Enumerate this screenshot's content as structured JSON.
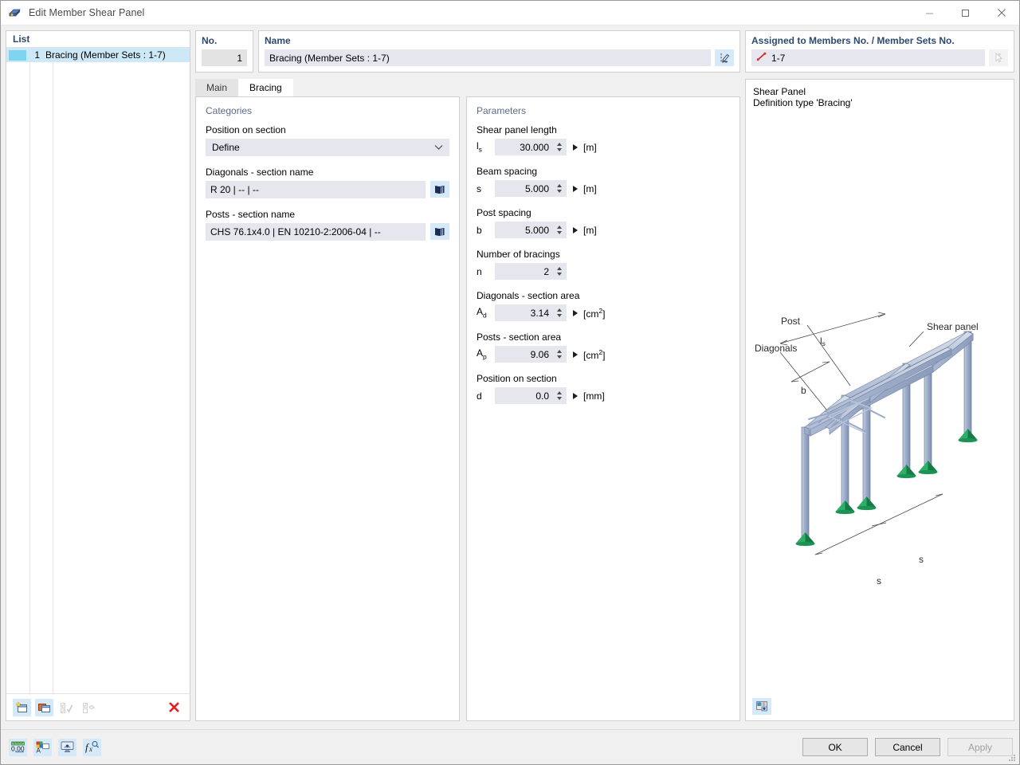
{
  "window": {
    "title": "Edit Member Shear Panel",
    "app_icon": "shear-panel-icon",
    "minimize_label": "—",
    "maximize_label": "□",
    "close_label": "✕"
  },
  "list_panel": {
    "header": "List",
    "rows": [
      {
        "color": "#7fd4f0",
        "no": "1",
        "label": "Bracing (Member Sets : 1-7)",
        "selected": true
      }
    ],
    "toolbar": [
      {
        "name": "new-item-button",
        "icon": "new-window-icon",
        "enabled": true
      },
      {
        "name": "copy-item-button",
        "icon": "copy-window-icon",
        "enabled": true
      },
      {
        "name": "select-all-button",
        "icon": "check-list-icon",
        "enabled": false
      },
      {
        "name": "invert-selection-button",
        "icon": "invert-list-icon",
        "enabled": false
      },
      {
        "name": "delete-item-button",
        "icon": "red-x-icon",
        "enabled": true
      }
    ]
  },
  "no_field": {
    "label": "No.",
    "value": "1"
  },
  "name_field": {
    "label": "Name",
    "value": "Bracing (Member Sets : 1-7)",
    "edit_button_icon": "pencil-edit-icon"
  },
  "assigned": {
    "label": "Assigned to Members No. / Member Sets No.",
    "value": "1-7",
    "value_icon": "member-line-icon",
    "pick_button_icon": "pick-cursor-icon",
    "pick_enabled": false
  },
  "tabs": [
    {
      "label": "Main",
      "active": false
    },
    {
      "label": "Bracing",
      "active": true
    }
  ],
  "categories": {
    "title": "Categories",
    "position_on_section": {
      "label": "Position on section",
      "value": "Define",
      "chevron": "chevron-down-icon"
    },
    "diagonals_section": {
      "label": "Diagonals - section name",
      "value": "R 20 | -- | --",
      "button_icon": "library-book-icon"
    },
    "posts_section": {
      "label": "Posts - section name",
      "value": "CHS 76.1x4.0 | EN 10210-2:2006-04 | --",
      "button_icon": "library-book-icon"
    }
  },
  "parameters": {
    "title": "Parameters",
    "rows": [
      {
        "label": "Shear panel length",
        "symbol": "l",
        "sub": "s",
        "value": "30.000",
        "unit": "[m]",
        "sup": "",
        "has_play": true
      },
      {
        "label": "Beam spacing",
        "symbol": "s",
        "sub": "",
        "value": "5.000",
        "unit": "[m]",
        "sup": "",
        "has_play": true
      },
      {
        "label": "Post spacing",
        "symbol": "b",
        "sub": "",
        "value": "5.000",
        "unit": "[m]",
        "sup": "",
        "has_play": true
      },
      {
        "label": "Number of bracings",
        "symbol": "n",
        "sub": "",
        "value": "2",
        "unit": "",
        "sup": "",
        "has_play": false
      },
      {
        "label": "Diagonals - section area",
        "symbol": "A",
        "sub": "d",
        "value": "3.14",
        "unit": "[cm",
        "sup": "2",
        "has_play": true
      },
      {
        "label": "Posts - section area",
        "symbol": "A",
        "sub": "p",
        "value": "9.06",
        "unit": "[cm",
        "sup": "2",
        "has_play": true
      },
      {
        "label": "Position on section",
        "symbol": "d",
        "sub": "",
        "value": "0.0",
        "unit": "[mm]",
        "sup": "",
        "has_play": true
      }
    ]
  },
  "graphic": {
    "caption_line1": "Shear Panel",
    "caption_line2": "Definition type 'Bracing'",
    "labels": {
      "shear_panel": "Shear panel",
      "post": "Post",
      "diagonals": "Diagonals",
      "ls": "l",
      "ls_sub": "s",
      "b": "b",
      "s1": "s",
      "s2": "s"
    },
    "print_button_icon": "picture-export-icon"
  },
  "footer": {
    "tools": [
      {
        "name": "units-button",
        "icon": "units-000-icon"
      },
      {
        "name": "comment-button",
        "icon": "comment-color-icon"
      },
      {
        "name": "display-properties-button",
        "icon": "display-monitor-icon"
      },
      {
        "name": "formula-button",
        "icon": "fx-formula-icon"
      }
    ],
    "ok_label": "OK",
    "cancel_label": "Cancel",
    "apply_label": "Apply",
    "apply_enabled": false
  },
  "colors": {
    "accent_header": "#2c4a6e",
    "group_title": "#5b6b8c",
    "field_bg": "#e6e6ee",
    "selection": "#cde8f7",
    "icon_btn_bg": "#d6e9f8",
    "delete_red": "#e02020",
    "steel_blue": "#a9b6d1",
    "support_green": "#1f9b53"
  }
}
